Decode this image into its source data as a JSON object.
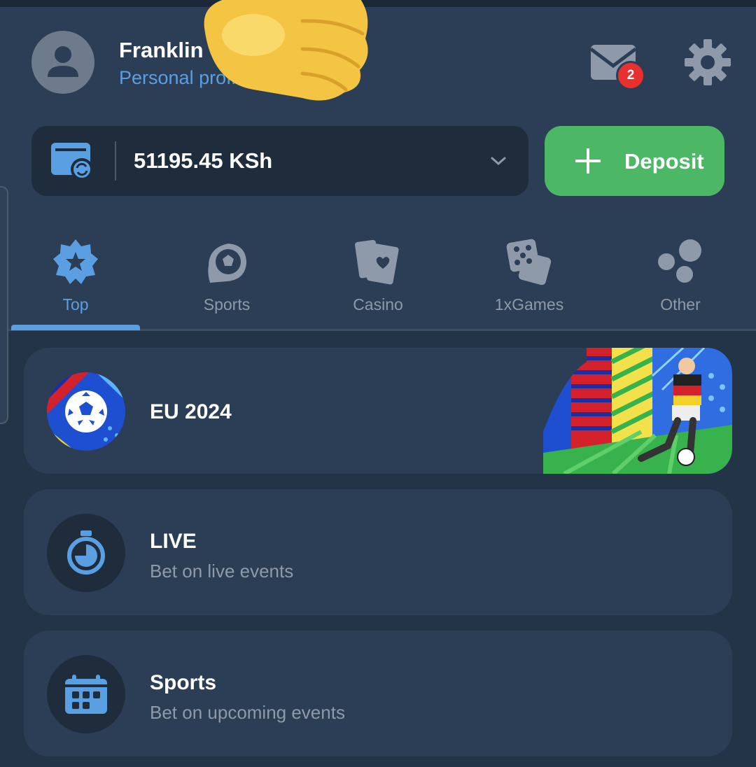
{
  "profile": {
    "name": "Franklin",
    "link_label": "Personal profile",
    "avatar_icon": "user-icon"
  },
  "notifications": {
    "icon": "mail-icon",
    "count": "2"
  },
  "settings": {
    "icon": "gear-icon"
  },
  "balance": {
    "amount": "51195.45 KSh",
    "icon": "wallet-sync-icon"
  },
  "deposit": {
    "label": "Deposit",
    "icon": "plus-icon"
  },
  "tabs": [
    {
      "label": "Top",
      "icon": "star-badge-icon",
      "active": true
    },
    {
      "label": "Sports",
      "icon": "soccer-ball-icon",
      "active": false
    },
    {
      "label": "Casino",
      "icon": "playing-cards-icon",
      "active": false
    },
    {
      "label": "1xGames",
      "icon": "dice-icon",
      "active": false
    },
    {
      "label": "Other",
      "icon": "bubbles-icon",
      "active": false
    }
  ],
  "cards": [
    {
      "title": "EU 2024",
      "icon": "eu-2024-ball-icon"
    },
    {
      "title": "LIVE",
      "subtitle": "Bet on live events",
      "icon": "stopwatch-icon"
    },
    {
      "title": "Sports",
      "subtitle": "Bet on upcoming events",
      "icon": "calendar-icon"
    }
  ],
  "colors": {
    "background": "#243447",
    "panel": "#2b3e55",
    "accent_blue": "#5b9fe3",
    "deposit_green": "#4cb866",
    "badge_red": "#e8312f",
    "muted_text": "#8e9aa9"
  }
}
